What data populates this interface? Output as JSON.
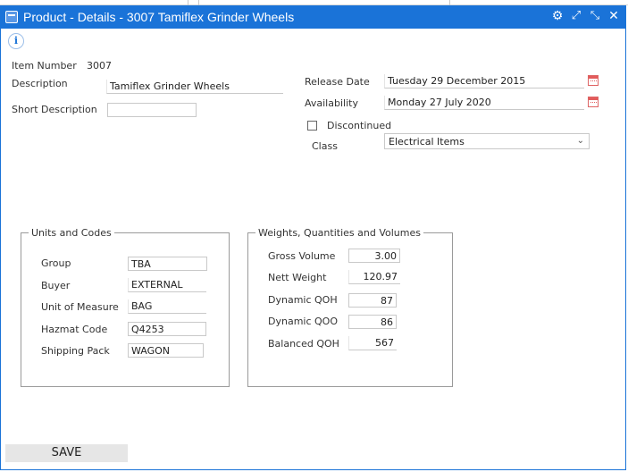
{
  "window": {
    "title": "Product - Details - 3007 Tamiflex Grinder Wheels"
  },
  "titlebar_icons": [
    "gear-icon",
    "expand-icon",
    "collapse-icon",
    "close-icon"
  ],
  "info": {
    "symbol": "i"
  },
  "item_number": {
    "label": "Item Number",
    "value": "3007"
  },
  "description": {
    "label": "Description",
    "value": "Tamiflex Grinder Wheels"
  },
  "short_description": {
    "label": "Short Description",
    "value": ""
  },
  "release_date": {
    "label": "Release Date",
    "value": "Tuesday 29 December 2015"
  },
  "availability": {
    "label": "Availability",
    "value": "Monday 27 July 2020"
  },
  "discontinued": {
    "label": "Discontinued",
    "checked": false
  },
  "class": {
    "label": "Class",
    "value": "Electrical Items"
  },
  "units_and_codes": {
    "legend": "Units and Codes",
    "group": {
      "label": "Group",
      "value": "TBA"
    },
    "buyer": {
      "label": "Buyer",
      "value": "EXTERNAL"
    },
    "unit_of_measure": {
      "label": "Unit of Measure",
      "value": "BAG"
    },
    "hazmat_code": {
      "label": "Hazmat Code",
      "value": "Q4253"
    },
    "shipping_pack": {
      "label": "Shipping Pack",
      "value": "WAGON"
    }
  },
  "weights": {
    "legend": "Weights, Quantities and Volumes",
    "gross_volume": {
      "label": "Gross Volume",
      "value": "3.00"
    },
    "nett_weight": {
      "label": "Nett Weight",
      "value": "120.97"
    },
    "dynamic_qoh": {
      "label": "Dynamic QOH",
      "value": "87"
    },
    "dynamic_qoo": {
      "label": "Dynamic QOO",
      "value": "86"
    },
    "balanced_qoh": {
      "label": "Balanced QOH",
      "value": "567"
    }
  },
  "actions": {
    "save_label": "SAVE"
  },
  "colors": {
    "titlebar": "#1a73d8",
    "calendar_icon": "#e35b5b"
  }
}
